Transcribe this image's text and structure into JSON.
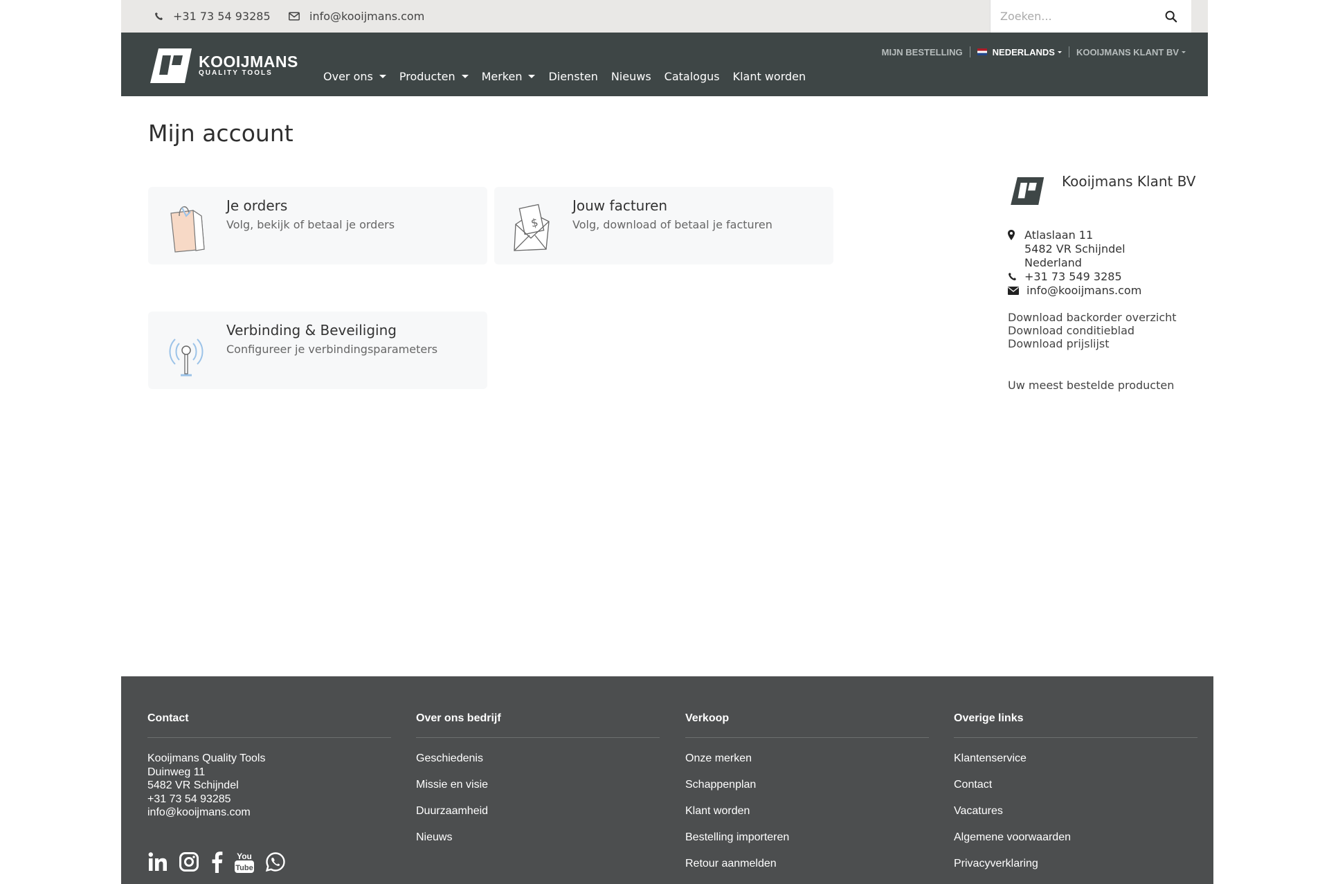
{
  "topbar": {
    "phone": "+31 73 54 93285",
    "email": "info@kooijmans.com",
    "search_placeholder": "Zoeken..."
  },
  "brand": {
    "name": "KOOIJMANS",
    "tagline": "QUALITY TOOLS"
  },
  "nav": {
    "items": [
      {
        "label": "Over ons",
        "dropdown": true
      },
      {
        "label": "Producten",
        "dropdown": true
      },
      {
        "label": "Merken",
        "dropdown": true
      },
      {
        "label": "Diensten",
        "dropdown": false
      },
      {
        "label": "Nieuws",
        "dropdown": false
      },
      {
        "label": "Catalogus",
        "dropdown": false
      },
      {
        "label": "Klant worden",
        "dropdown": false
      }
    ],
    "order_link": "MIJN BESTELLING",
    "language": "NEDERLANDS",
    "account": "KOOIJMANS KLANT BV"
  },
  "page": {
    "title": "Mijn account",
    "cards": [
      {
        "title": "Je orders",
        "subtitle": "Volg, bekijk of betaal je orders",
        "icon": "shopping-bag-icon"
      },
      {
        "title": "Jouw facturen",
        "subtitle": "Volg, download of betaal je facturen",
        "icon": "invoice-envelope-icon"
      },
      {
        "title": "Verbinding & Beveiliging",
        "subtitle": "Configureer je verbindingsparameters",
        "icon": "antenna-icon"
      }
    ]
  },
  "sidebar": {
    "company": "Kooijmans Klant BV",
    "address": [
      "Atlaslaan 11",
      "5482 VR Schijndel",
      "Nederland"
    ],
    "phone": "+31 73 549 3285",
    "email": "info@kooijmans.com",
    "downloads": [
      "Download backorder overzicht",
      "Download conditieblad",
      "Download prijslijst"
    ],
    "most_ordered": "Uw meest bestelde producten"
  },
  "footer": {
    "contact": {
      "heading": "Contact",
      "lines": [
        "Kooijmans Quality Tools",
        "Duinweg 11",
        "5482 VR Schijndel",
        "+31 73 54 93285",
        "info@kooijmans.com"
      ]
    },
    "about": {
      "heading": "Over ons bedrijf",
      "links": [
        "Geschiedenis",
        "Missie en visie",
        "Duurzaamheid",
        "Nieuws"
      ]
    },
    "sales": {
      "heading": "Verkoop",
      "links": [
        "Onze merken",
        "Schappenplan",
        "Klant worden",
        "Bestelling importeren",
        "Retour aanmelden"
      ]
    },
    "other": {
      "heading": "Overige links",
      "links": [
        "Klantenservice",
        "Contact",
        "Vacatures",
        "Algemene voorwaarden",
        "Privacyverklaring"
      ]
    },
    "social_icons": [
      "linkedin-icon",
      "instagram-icon",
      "facebook-icon",
      "youtube-icon",
      "whatsapp-icon"
    ]
  },
  "colors": {
    "nav_bg": "#3e4646",
    "topbar_bg": "#e9e8e6",
    "footer_bg": "#4c4e4f",
    "card_bg": "#f7f8f9"
  }
}
